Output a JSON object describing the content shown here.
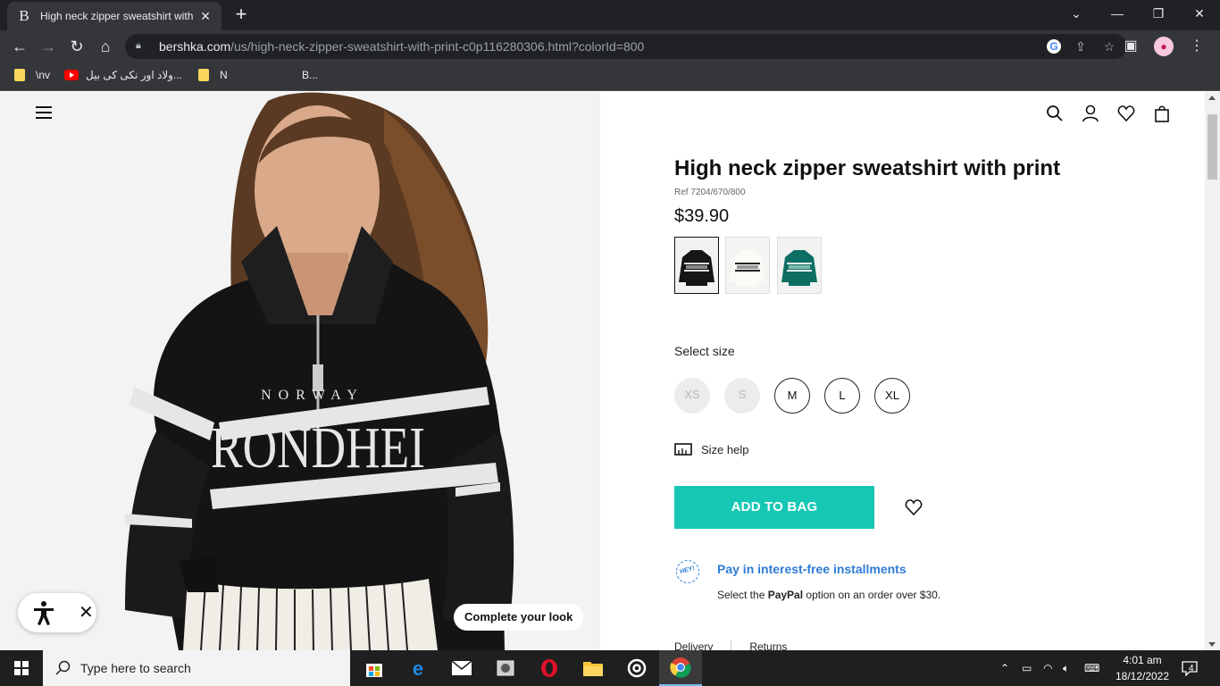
{
  "browser": {
    "tab_title": "High neck zipper sweatshirt with",
    "tab_favicon": "B",
    "url_host": "bershka.com",
    "url_path": "/us/high-neck-zipper-sweatshirt-with-print-c0p116280306.html?colorId=800"
  },
  "bookmarks": [
    {
      "label": "\\nv",
      "icon": "folder-icon"
    },
    {
      "label": "ولاد اور نکی کی بیل...",
      "icon": "youtube-icon"
    },
    {
      "label": "N",
      "icon": "folder-icon"
    },
    {
      "label": "B...",
      "icon": "none"
    }
  ],
  "product": {
    "title": "High neck zipper sweatshirt with print",
    "ref": "Ref 7204/670/800",
    "price": "$39.90",
    "colors": [
      "black",
      "white",
      "green"
    ],
    "select_size_label": "Select size",
    "sizes": [
      {
        "label": "XS",
        "available": false
      },
      {
        "label": "S",
        "available": false
      },
      {
        "label": "M",
        "available": true
      },
      {
        "label": "L",
        "available": true
      },
      {
        "label": "XL",
        "available": true
      }
    ],
    "size_help": "Size help",
    "add_to_bag": "ADD TO BAG",
    "hey_badge": "HEY!",
    "pay_title": "Pay in interest-free installments",
    "pay_sub_before": "Select the ",
    "pay_sub_brand": "PayPal",
    "pay_sub_after": " option on an order over $30.",
    "tabs": [
      "Delivery",
      "Returns"
    ]
  },
  "hero": {
    "print_top": "NORWAY",
    "print_main": "RONDHEI",
    "complete_look": "Complete your look"
  },
  "colors": {
    "accent": "#16c8b4",
    "paypal_blue": "#2f7bd6"
  },
  "taskbar": {
    "search_placeholder": "Type here to search",
    "time": "4:01 am",
    "date": "18/12/2022",
    "notifications": "4"
  }
}
